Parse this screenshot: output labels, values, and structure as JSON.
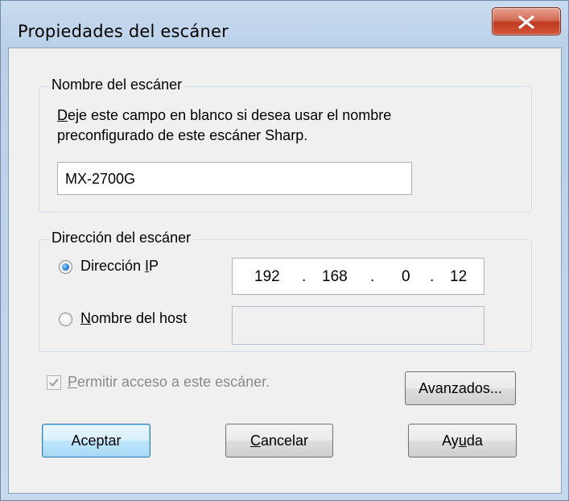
{
  "window": {
    "title": "Propiedades del escáner"
  },
  "name_group": {
    "legend": "Nombre del escáner",
    "hint_line1_first": "D",
    "hint_line1_rest": "eje este campo en blanco si desea usar el nombre",
    "hint_line2": "preconfigurado de este escáner Sharp.",
    "name_value": "MX-2700G"
  },
  "address_group": {
    "legend": "Dirección del escáner",
    "ip_label_pre": "Dirección ",
    "ip_label_accel": "I",
    "ip_label_post": "P",
    "ip_selected": true,
    "ip_octets": [
      "192",
      "168",
      "0",
      "12"
    ],
    "ip_dot": ".",
    "host_label_accel": "N",
    "host_label_rest": "ombre del host",
    "host_value": ""
  },
  "access": {
    "checked": true,
    "label_accel": "P",
    "label_rest": "ermitir acceso a este escáner."
  },
  "buttons": {
    "advanced": "Avanzados...",
    "ok": "Aceptar",
    "cancel_accel": "C",
    "cancel_rest": "ancelar",
    "help_pre": "Ay",
    "help_accel": "u",
    "help_post": "da"
  },
  "colors": {
    "accent_radio": "#2b7fd6",
    "close_button": "#c0391f",
    "default_button_border": "#3c7fb1"
  }
}
